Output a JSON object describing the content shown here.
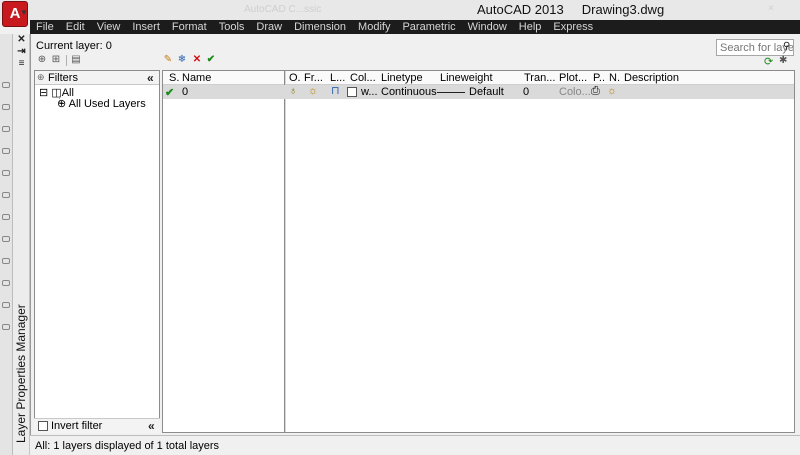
{
  "window": {
    "app_title": "AutoCAD 2013",
    "document": "Drawing3.dwg",
    "ghost_title": "AutoCAD C...ssic",
    "logo_letter": "A"
  },
  "menu": [
    "File",
    "Edit",
    "View",
    "Insert",
    "Format",
    "Tools",
    "Draw",
    "Dimension",
    "Modify",
    "Parametric",
    "Window",
    "Help",
    "Express"
  ],
  "palette": {
    "title": "Layer Properties Manager",
    "close_glyph": "✕"
  },
  "header": {
    "current_layer": "Current layer: 0",
    "search_placeholder": "Search for laye"
  },
  "filters": {
    "heading": "Filters",
    "collapse_glyph": "«",
    "tree_root": "All",
    "tree_child": "All Used Layers",
    "invert_label": "Invert filter"
  },
  "columns": {
    "status": "S.",
    "name": "Name",
    "on": "O.",
    "freeze": "Fr...",
    "lock": "L...",
    "color": "Col...",
    "linetype": "Linetype",
    "lineweight": "Lineweight",
    "transparency": "Tran...",
    "plot_style": "Plot...",
    "plot": "P..",
    "new_vp_freeze": "N.",
    "description": "Description"
  },
  "layers": [
    {
      "status_glyph": "✔",
      "name": "0",
      "color": "w...",
      "linetype": "Continuous",
      "lineweight": "Default",
      "transparency": "0",
      "plot_style": "Colo..."
    }
  ],
  "status": {
    "text": "All: 1 layers displayed of 1 total layers"
  },
  "colors": {
    "accent_red": "#c8191e",
    "check_green": "#1a8a1a",
    "delete_red": "#d01010",
    "menubar": "#1c1c1c"
  }
}
